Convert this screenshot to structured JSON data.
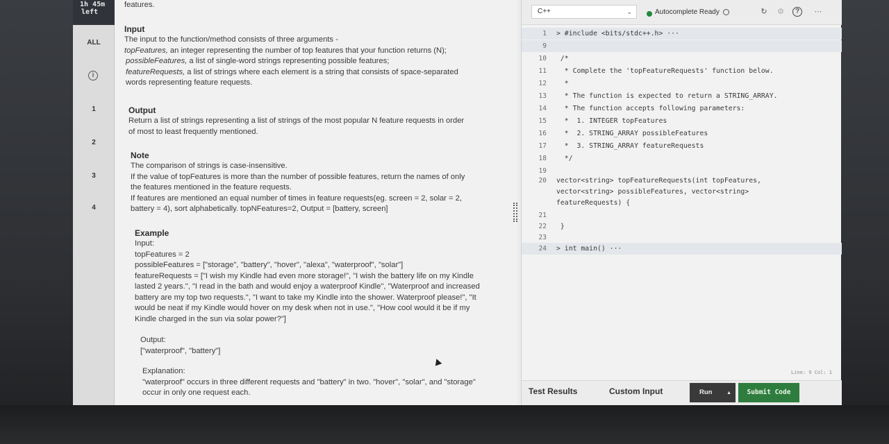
{
  "timer": {
    "line1": "1h 45m",
    "line2": "left"
  },
  "rail": {
    "all": "ALL",
    "info": "i",
    "q1": "1",
    "q2": "2",
    "q3": "3",
    "q4": "4"
  },
  "problem": {
    "top_fragment": "features.",
    "input_heading": "Input",
    "input_line1": "The input to the function/method consists of three arguments -",
    "input_line2_em": "topFeatures,",
    "input_line2": " an integer representing the number of top features that your function returns (N);",
    "input_line3_em": "possibleFeatures,",
    "input_line3": " a list of single-word strings representing possible features;",
    "input_line4_em": "featureRequests,",
    "input_line4": " a list of strings where each element is a string that consists of space-separated",
    "input_line5": "words representing feature requests.",
    "output_heading": "Output",
    "output_line1": "Return a list of strings representing a list of strings of the most popular N feature requests in order",
    "output_line2": "of most to least frequently mentioned.",
    "note_heading": "Note",
    "note_line1": "The comparison of strings is case-insensitive.",
    "note_line2": "If the value of topFeatures is more than the number of possible features, return the names of only",
    "note_line3": "the features mentioned in the feature requests.",
    "note_line4": "If features are mentioned an equal number of times in feature requests(eg. screen = 2, solar = 2,",
    "note_line5": "battery = 4), sort alphabetically. topNFeatures=2, Output = [battery, screen]",
    "example_heading": "Example",
    "ex_input": "Input:",
    "ex_top": "topFeatures = 2",
    "ex_possible": "possibleFeatures = [\"storage\", \"battery\", \"hover\", \"alexa\", \"waterproof\", \"solar\"]",
    "ex_req1": "featureRequests = [\"I wish my Kindle had even more storage!\", \"I wish the battery life on my Kindle",
    "ex_req2": "lasted 2 years.\", \"I read in the bath and would enjoy a waterproof Kindle\", \"Waterproof and increased",
    "ex_req3": "battery are my top two requests.\", \"I want to take my Kindle into the shower. Waterproof please!\", \"It",
    "ex_req4": "would be neat if my Kindle would hover on my desk when not in use.\", \"How cool would it be if my",
    "ex_req5": "Kindle charged in the sun via solar power?\"]",
    "ex_output_label": "Output:",
    "ex_output": "[\"waterproof\", \"battery\"]",
    "ex_expl_label": "Explanation:",
    "ex_expl1": "\"waterproof\" occurs in three different requests and \"battery\" in two. \"hover\", \"solar\", and \"storage\"",
    "ex_expl2": "occur in only one request each."
  },
  "editor": {
    "language": "C++",
    "status": "Autocomplete Ready",
    "lines": [
      {
        "n": "1",
        "t": "> #include <bits/stdc++.h> ···"
      },
      {
        "n": "9",
        "t": ""
      },
      {
        "n": "10",
        "t": " /*"
      },
      {
        "n": "11",
        "t": "  * Complete the 'topFeatureRequests' function below."
      },
      {
        "n": "12",
        "t": "  *"
      },
      {
        "n": "13",
        "t": "  * The function is expected to return a STRING_ARRAY."
      },
      {
        "n": "14",
        "t": "  * The function accepts following parameters:"
      },
      {
        "n": "15",
        "t": "  *  1. INTEGER topFeatures"
      },
      {
        "n": "16",
        "t": "  *  2. STRING_ARRAY possibleFeatures"
      },
      {
        "n": "17",
        "t": "  *  3. STRING_ARRAY featureRequests"
      },
      {
        "n": "18",
        "t": "  */"
      },
      {
        "n": "19",
        "t": ""
      },
      {
        "n": "20",
        "t": "vector<string> topFeatureRequests(int topFeatures,"
      },
      {
        "n": "",
        "t": "vector<string> possibleFeatures, vector<string>"
      },
      {
        "n": "",
        "t": "featureRequests) {"
      },
      {
        "n": "21",
        "t": ""
      },
      {
        "n": "22",
        "t": " }"
      },
      {
        "n": "23",
        "t": ""
      },
      {
        "n": "24",
        "t": "> int main() ···"
      }
    ],
    "line_col": "Line: 9 Col: 1",
    "test_results": "Test Results",
    "custom_input": "Custom Input",
    "run": "Run",
    "run_arrow": "▲",
    "submit": "Submit Code"
  }
}
